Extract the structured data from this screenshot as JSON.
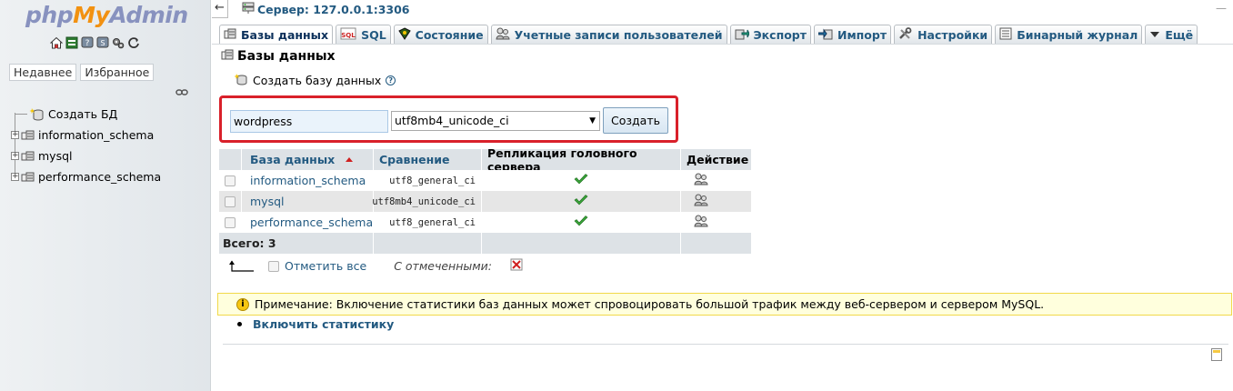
{
  "nav": {
    "logo_php": "php",
    "logo_my": "My",
    "logo_admin": "Admin",
    "icons": [
      "home-icon",
      "exit-icon",
      "help-icon",
      "docs-icon",
      "settings-icon",
      "reload-icon"
    ],
    "tabs": [
      "Недавнее",
      "Избранное"
    ],
    "tree": [
      {
        "label": "Создать БД",
        "icon": "new-db-icon"
      },
      {
        "label": "information_schema",
        "icon": "database-icon"
      },
      {
        "label": "mysql",
        "icon": "database-icon"
      },
      {
        "label": "performance_schema",
        "icon": "database-icon"
      }
    ]
  },
  "topbar": {
    "toggle": "←",
    "server": "Сервер: 127.0.0.1:3306"
  },
  "tabs": [
    {
      "label": "Базы данных",
      "icon": "databases-icon",
      "active": true
    },
    {
      "label": "SQL",
      "icon": "sql-icon"
    },
    {
      "label": "Состояние",
      "icon": "status-icon"
    },
    {
      "label": "Учетные записи пользователей",
      "icon": "users-icon"
    },
    {
      "label": "Экспорт",
      "icon": "export-icon"
    },
    {
      "label": "Импорт",
      "icon": "import-icon"
    },
    {
      "label": "Настройки",
      "icon": "settings-icon"
    },
    {
      "label": "Бинарный журнал",
      "icon": "binlog-icon"
    },
    {
      "label": "Ещё",
      "icon": "chevron-down-icon"
    }
  ],
  "page": {
    "title": "Базы данных",
    "create_db_label": "Создать базу данных"
  },
  "create_form": {
    "db_name_value": "wordpress",
    "collation_value": "utf8mb4_unicode_ci",
    "create_button": "Создать"
  },
  "table": {
    "headers": {
      "database": "База данных",
      "collation": "Сравнение",
      "replication": "Репликация головного сервера",
      "action": "Действие"
    },
    "rows": [
      {
        "name": "information_schema",
        "collation": "utf8_general_ci"
      },
      {
        "name": "mysql",
        "collation": "utf8mb4_unicode_ci"
      },
      {
        "name": "performance_schema",
        "collation": "utf8_general_ci"
      }
    ],
    "total": "Всего: 3"
  },
  "bulk": {
    "check_all": "Отметить все",
    "with_selected": "С отмеченными:"
  },
  "notice": {
    "text": "Примечание: Включение статистики баз данных может спровоцировать большой трафик между веб-сервером и сервером MySQL.",
    "enable_stats": "Включить статистику"
  },
  "colors": {
    "link": "#235a81",
    "highlight_border": "#d9202a",
    "notice_bg": "#ffffdd"
  }
}
